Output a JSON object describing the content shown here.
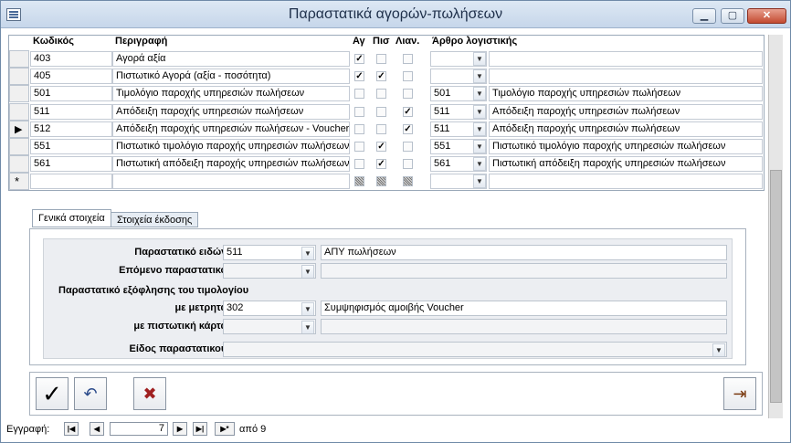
{
  "window": {
    "title": "Παραστατικά αγορών-πωλήσεων"
  },
  "grid": {
    "headers": {
      "code": "Κωδικός",
      "description": "Περιγραφή",
      "ag": "Αγ",
      "pis": "Πισ",
      "lian": "Λιαν.",
      "article": "Άρθρο λογιστικής"
    },
    "rows": [
      {
        "code": "403",
        "description": "Αγορά αξία",
        "ag": true,
        "pis": false,
        "lian": false,
        "art_code": "",
        "art_desc": "",
        "current": false
      },
      {
        "code": "405",
        "description": "Πιστωτικό Αγορά (αξία - ποσότητα)",
        "ag": true,
        "pis": true,
        "lian": false,
        "art_code": "",
        "art_desc": "",
        "current": false
      },
      {
        "code": "501",
        "description": "Τιμολόγιο παροχής υπηρεσιών πωλήσεων",
        "ag": false,
        "pis": false,
        "lian": false,
        "art_code": "501",
        "art_desc": "Τιμολόγιο παροχής υπηρεσιών πωλήσεων",
        "current": false
      },
      {
        "code": "511",
        "description": "Απόδειξη παροχής υπηρεσιών πωλήσεων",
        "ag": false,
        "pis": false,
        "lian": true,
        "art_code": "511",
        "art_desc": "Απόδειξη παροχής υπηρεσιών πωλήσεων",
        "current": false
      },
      {
        "code": "512",
        "description": "Απόδειξη παροχής υπηρεσιών πωλήσεων - Voucher",
        "ag": false,
        "pis": false,
        "lian": true,
        "art_code": "511",
        "art_desc": "Απόδειξη παροχής υπηρεσιών πωλήσεων",
        "current": true
      },
      {
        "code": "551",
        "description": "Πιστωτικό τιμολόγιο παροχής υπηρεσιών πωλήσεων",
        "ag": false,
        "pis": true,
        "lian": false,
        "art_code": "551",
        "art_desc": "Πιστωτικό τιμολόγιο παροχής υπηρεσιών πωλήσεων",
        "current": false
      },
      {
        "code": "561",
        "description": "Πιστωτική απόδειξη παροχής υπηρεσιών πωλήσεων",
        "ag": false,
        "pis": true,
        "lian": false,
        "art_code": "561",
        "art_desc": "Πιστωτική απόδειξη παροχής υπηρεσιών πωλήσεων",
        "current": false
      }
    ],
    "new_row_marker": "*"
  },
  "tabs": [
    {
      "label": "Γενικά στοιχεία",
      "active": true
    },
    {
      "label": "Στοιχεία έκδοσης",
      "active": false
    }
  ],
  "form": {
    "doc_type_label": "Παραστατικό ειδών :",
    "doc_type_code": "511",
    "doc_type_desc": "ΑΠΥ πωλήσεων",
    "next_doc_label": "Επόμενο παραστατικό :",
    "settlement_heading": "Παραστατικό εξόφλησης του τιμολογίου",
    "cash_label": "με μετρητά :",
    "cash_code": "302",
    "cash_desc": "Συμψηφισμός αμοιβής Voucher",
    "card_label": "με πιστωτική κάρτα :",
    "kind_label": "Είδος παραστατικού :"
  },
  "nav": {
    "label": "Εγγραφή:",
    "current": "7",
    "of_label": "από 9"
  }
}
